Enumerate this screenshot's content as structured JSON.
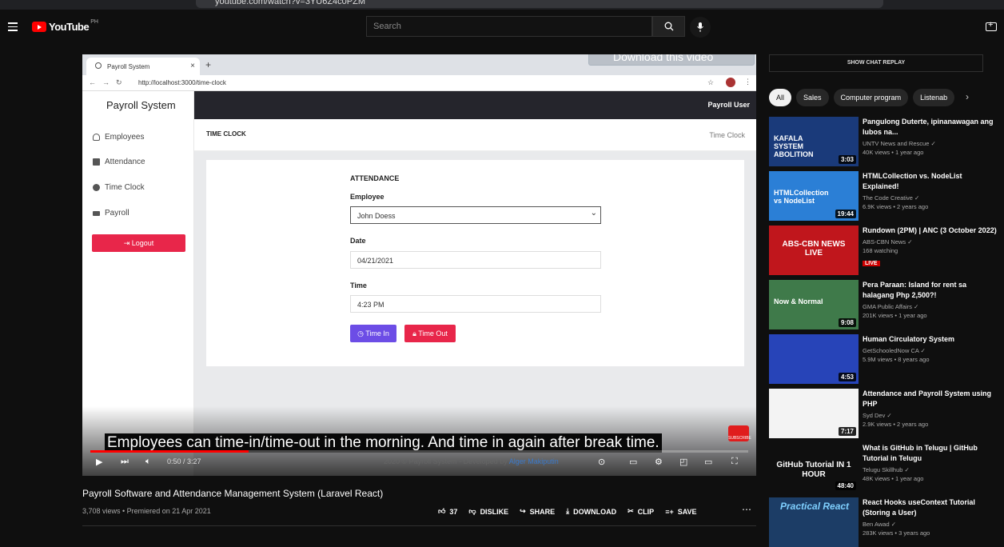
{
  "browser": {
    "url": "youtube.com/watch?v=3YU6Z4c0PZM"
  },
  "header": {
    "logo": "YouTube",
    "country_code": "PH",
    "search_placeholder": "Search",
    "icons": [
      "menu-icon",
      "search-icon",
      "mic-icon",
      "create-icon"
    ]
  },
  "player": {
    "inner_browser": {
      "tab_title": "Payroll System",
      "url": "http://localhost:3000/time-clock"
    },
    "download_overlay": "Download this video",
    "app": {
      "brand": "Payroll System",
      "user": "Payroll User",
      "nav": [
        {
          "label": "Employees",
          "icon": "user-icon"
        },
        {
          "label": "Attendance",
          "icon": "calendar-icon"
        },
        {
          "label": "Time Clock",
          "icon": "clock-icon"
        },
        {
          "label": "Payroll",
          "icon": "card-icon"
        }
      ],
      "logout": "Logout",
      "page_title": "TIME CLOCK",
      "breadcrumb": "Time Clock",
      "form": {
        "heading": "ATTENDANCE",
        "employee_label": "Employee",
        "employee_value": "John Doess",
        "date_label": "Date",
        "date_value": "04/21/2021",
        "time_label": "Time",
        "time_value": "4:23 PM",
        "time_in": "Time In",
        "time_out": "Time Out"
      },
      "footer": "2020 © Payroll System - Developed by",
      "footer_author": "Alger Makiputin"
    },
    "caption": "Employees can time-in/time-out in the morning. And time in again after break time.",
    "subscribe": "SUBSCRIBE",
    "time": "0:50 / 3:27",
    "progress": 0.24
  },
  "video": {
    "title": "Payroll Software and Attendance Management System (Laravel React)",
    "meta": "3,708 views • Premiered on 21 Apr 2021",
    "likes": "37",
    "dislike": "DISLIKE",
    "share": "SHARE",
    "download": "DOWNLOAD",
    "clip": "CLIP",
    "save": "SAVE"
  },
  "sidebar": {
    "chat_replay": "SHOW CHAT REPLAY",
    "chips": [
      "All",
      "Sales",
      "Computer program",
      "Listenab"
    ],
    "recommendations": [
      {
        "title": "Pangulong Duterte, ipinanawagan ang lubos na...",
        "channel": "UNTV News and Rescue",
        "stats": "40K views • 1 year ago",
        "duration": "3:03",
        "thumb_color": "#1a3a7a",
        "thumb_text": "KAFALA SYSTEM ABOLITION"
      },
      {
        "title": "HTMLCollection vs. NodeList Explained!",
        "channel": "The Code Creative",
        "stats": "6.9K views • 2 years ago",
        "duration": "19:44",
        "thumb_color": "#2b7fd6",
        "thumb_text": "HTMLCollection vs NodeList"
      },
      {
        "title": "Rundown (2PM) | ANC (3 October 2022)",
        "channel": "ABS-CBN News",
        "stats": "168 watching",
        "live": "LIVE",
        "thumb_color": "#c0161c",
        "thumb_text": "ABS-CBN NEWS LIVE"
      },
      {
        "title": "Pera Paraan: Island for rent sa halagang Php 2,500?!",
        "channel": "GMA Public Affairs",
        "stats": "201K views • 1 year ago",
        "duration": "9:08",
        "thumb_color": "#3f7a4a",
        "thumb_text": "Now & Normal"
      },
      {
        "title": "Human Circulatory System",
        "channel": "GetSchooledNow CA",
        "stats": "5.9M views • 8 years ago",
        "duration": "4:53",
        "thumb_color": "#2744b8",
        "thumb_text": ""
      },
      {
        "title": "Attendance and Payroll System using PHP",
        "channel": "Syd Dev",
        "stats": "2.9K views • 2 years ago",
        "duration": "7:17",
        "thumb_color": "#f3f3f3",
        "thumb_text": ""
      },
      {
        "title": "What is GitHub in Telugu | GitHub Tutorial in Telugu",
        "channel": "Telugu Skillhub",
        "stats": "48K views • 1 year ago",
        "duration": "48:40",
        "thumb_color": "#0f0f0f",
        "thumb_text": "GitHub Tutorial IN 1 HOUR"
      },
      {
        "title": "Rundown (2PM) | ANC (3 October 2022)",
        "channel": "ABS-CBN News",
        "stats": "168 watching",
        "duration": "",
        "thumb_color": "#0f0f0f",
        "thumb_text": ""
      }
    ],
    "last_rec": {
      "title": "React Hooks useContext Tutorial (Storing a User)",
      "channel": "Ben Awad",
      "stats": "283K views • 3 years ago",
      "thumb_text": "Practical React"
    }
  }
}
